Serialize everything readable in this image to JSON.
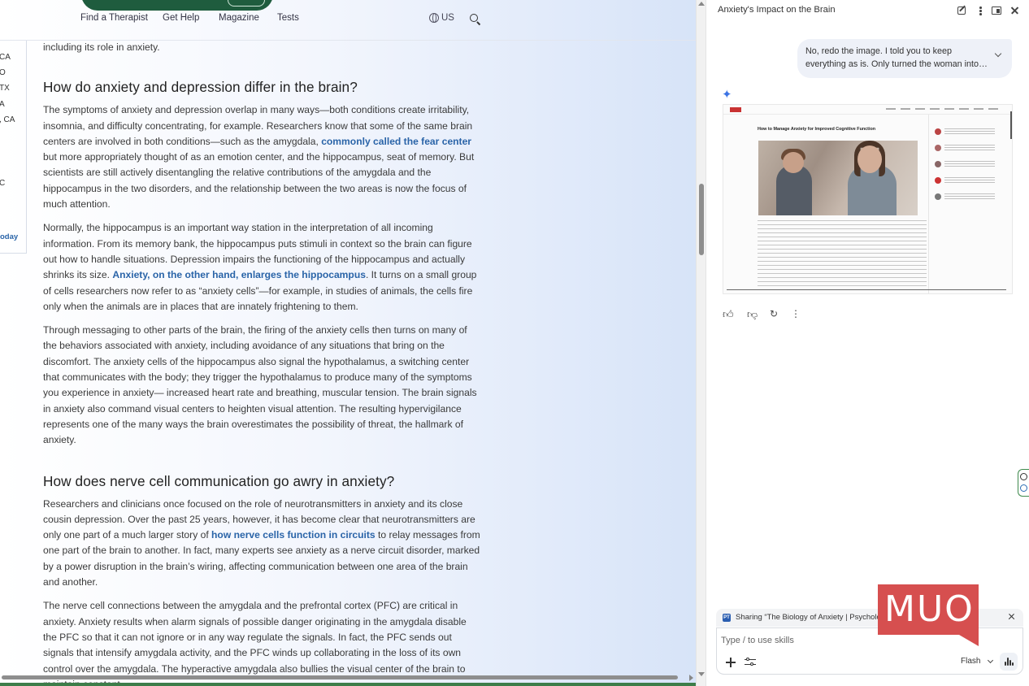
{
  "nav": {
    "links": [
      "Find a Therapist",
      "Get Help",
      "Magazine",
      "Tests"
    ],
    "region": "US"
  },
  "left_rail": {
    "items": [
      "CA",
      "O",
      "TX",
      "A",
      ", CA",
      "C"
    ],
    "link": "oday"
  },
  "article": {
    "intro_tail": "including its role in anxiety.",
    "h1": "How do anxiety and depression differ in the brain?",
    "p1_a": "The symptoms of anxiety and depression overlap in many ways—both conditions create irritability, insomnia, and difficulty concentrating, for example. Researchers know that some of the same brain centers are involved in both conditions—such as the amygdala, ",
    "p1_link": "commonly called the fear center",
    "p1_b": " but more appropriately thought of as an emotion center, and the hippocampus, seat of memory. But scientists are still actively disentangling the relative contributions of the amygdala and the hippocampus in the two disorders, and the relationship between the two areas is now the focus of much attention.",
    "p2_a": "Normally, the hippocampus is an important way station in the interpretation of all incoming information. From its memory bank, the hippocampus puts stimuli in context so the brain can figure out how to handle situations. Depression impairs the functioning of the hippocampus and actually shrinks its size. ",
    "p2_link": "Anxiety, on the other hand, enlarges the hippocampus",
    "p2_b": ". It turns on a small group of cells researchers now refer to as “anxiety cells”—for example, in studies of animals, the cells fire only when the animals are in places that are innately frightening to them.",
    "p3": "Through messaging to other parts of the brain, the firing of the anxiety cells then turns on many of the behaviors associated with anxiety, including avoidance of any situations that bring on the discomfort. The anxiety cells of the hippocampus also signal the hypothalamus, a switching center that communicates with the body; they trigger the hypothalamus to produce many of the symptoms you experience in anxiety— increased heart rate and breathing, muscular tension. The brain signals in anxiety also command visual centers to heighten visual attention. The resulting hypervigilance represents one of the many ways the brain overestimates the possibility of threat, the hallmark of anxiety.",
    "h2": "How does nerve cell communication go awry in anxiety?",
    "p4_a": "Researchers and clinicians once focused on the role of neurotransmitters in anxiety and its close cousin depression. Over the past 25 years, however, it has become clear that neurotransmitters are only one part of a much larger story of ",
    "p4_link": "how nerve cells function in circuits",
    "p4_b": " to relay messages from one part of the brain to another. In fact, many experts see anxiety as a nerve circuit disorder, marked by a power disruption in the brain’s wiring, affecting communication between one area of the brain and another.",
    "p5": "The nerve cell connections between the amygdala and the prefrontal cortex (PFC) are critical in anxiety. Anxiety results when alarm signals of possible danger originating in the amygdala disable the PFC so that it can not ignore or in any way regulate the signals. In fact, the PFC sends out signals that intensify amygdala activity, and the PFC winds up collaborating in the loss of its own control over the amygdala. The hyperactive amygdala also bullies the visual center of the brain to maintain constant"
  },
  "panel": {
    "title": "Anxiety's Impact on the Brain",
    "user_message": "No, redo the image. I told you to keep everything as is. Only turned the woman into a...",
    "generated_image": {
      "headline": "How to Manage Anxiety for Improved Cognitive Function"
    },
    "share_text": "Sharing “The Biology of Anxiety | Psychology Today”",
    "share_favicon": "PT",
    "composer_placeholder": "Type / to use skills",
    "model": "Flash"
  },
  "watermark": "MUO",
  "colors": {
    "link": "#2a64a8",
    "accent_green": "#1f5c3e",
    "watermark_red": "#d64f4f",
    "sparkle_blue": "#3b73e4"
  }
}
